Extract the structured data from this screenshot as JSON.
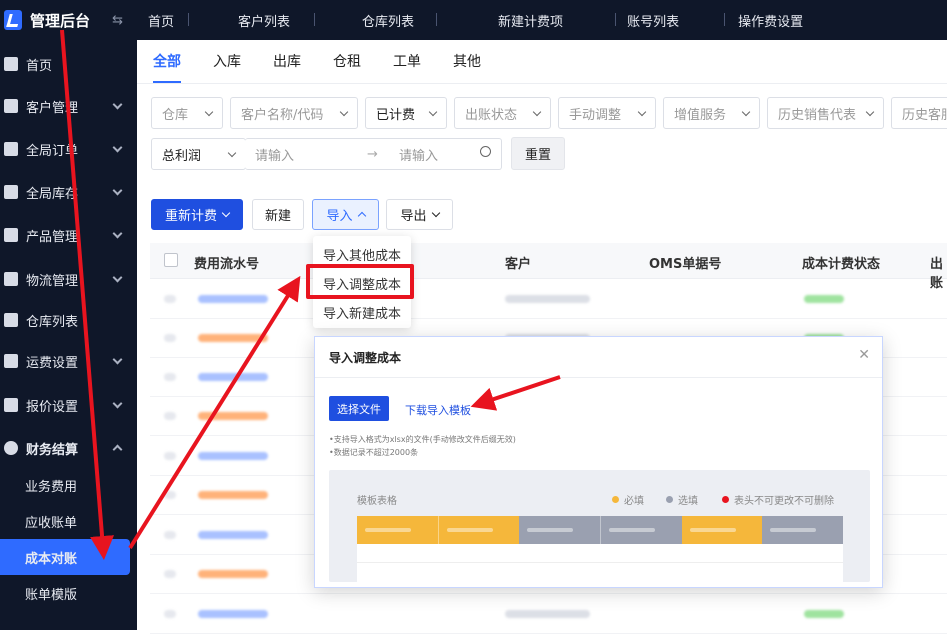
{
  "brand": {
    "title": "管理后台"
  },
  "sidebar": {
    "items": [
      {
        "label": "首页",
        "expandable": false
      },
      {
        "label": "客户管理",
        "expandable": true
      },
      {
        "label": "全局订单",
        "expandable": true
      },
      {
        "label": "全局库存",
        "expandable": true
      },
      {
        "label": "产品管理",
        "expandable": true
      },
      {
        "label": "物流管理",
        "expandable": true
      },
      {
        "label": "仓库列表",
        "expandable": false
      },
      {
        "label": "运费设置",
        "expandable": true
      },
      {
        "label": "报价设置",
        "expandable": true
      },
      {
        "label": "财务结算",
        "expandable": true,
        "expanded": true
      }
    ],
    "sub_items": [
      "业务费用",
      "应收账单",
      "成本对账",
      "账单模版"
    ],
    "active_sub": "成本对账"
  },
  "topnav": [
    "首页",
    "客户列表",
    "仓库列表",
    "新建计费项",
    "账号列表",
    "操作费设置"
  ],
  "tabs": [
    "全部",
    "入库",
    "出库",
    "仓租",
    "工单",
    "其他"
  ],
  "active_tab": "全部",
  "filters": {
    "warehouse": "仓库",
    "customer": "客户名称/代码",
    "billed": "已计费",
    "bill_status": "出账状态",
    "manual_adjust": "手动调整",
    "value_added": "增值服务",
    "sales_rep": "历史销售代表",
    "history_customer": "历史客服",
    "profit_select": "总利润",
    "range_from_placeholder": "请输入",
    "range_to_placeholder": "请输入",
    "reset": "重置"
  },
  "toolbar": {
    "recalc": "重新计费",
    "new": "新建",
    "import": "导入",
    "export": "导出"
  },
  "import_menu": [
    "导入其他成本",
    "导入调整成本",
    "导入新建成本"
  ],
  "table": {
    "headers": [
      "费用流水号",
      "客户",
      "OMS单据号",
      "成本计费状态",
      "出账"
    ]
  },
  "modal": {
    "title": "导入调整成本",
    "select_file": "选择文件",
    "download_template": "下载导入模板",
    "note1": "•支持导入格式为xlsx的文件(手动修改文件后缀无效)",
    "note2": "•数据记录不超过2000条",
    "template_title": "模板表格",
    "legend": [
      {
        "label": "必填",
        "color": "#f5b73b"
      },
      {
        "label": "选填",
        "color": "#9aa0b0"
      },
      {
        "label": "表头不可更改不可删除",
        "color": "#e8141f"
      }
    ]
  },
  "colors": {
    "accent": "#1f4fe0",
    "sidebar": "#0f1729",
    "annotation": "#e8141f"
  }
}
